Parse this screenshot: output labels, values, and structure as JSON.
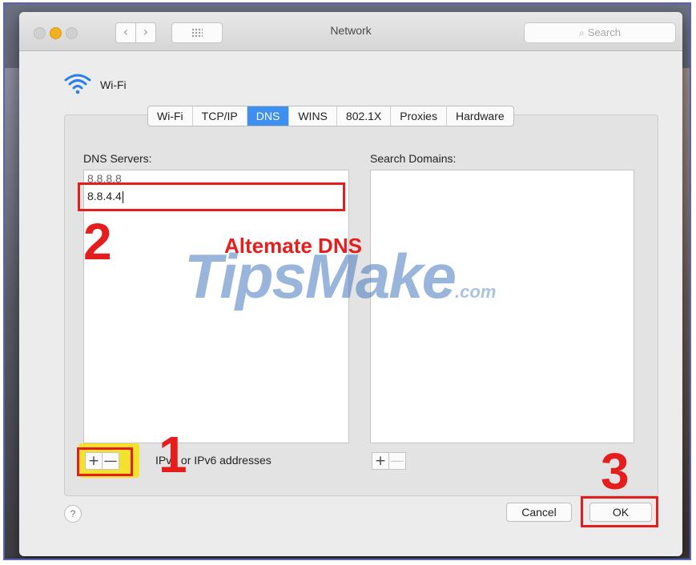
{
  "window": {
    "title": "Network"
  },
  "toolbar": {
    "back_glyph": "‹",
    "forward_glyph": "›",
    "search_placeholder": "Search",
    "icons": {
      "search": "search-icon",
      "grid": "show-all-grid-icon"
    }
  },
  "interface": {
    "name": "Wi-Fi",
    "icon": "wifi-icon"
  },
  "tabs": [
    {
      "label": "Wi-Fi",
      "active": false
    },
    {
      "label": "TCP/IP",
      "active": false
    },
    {
      "label": "DNS",
      "active": true
    },
    {
      "label": "WINS",
      "active": false
    },
    {
      "label": "802.1X",
      "active": false
    },
    {
      "label": "Proxies",
      "active": false
    },
    {
      "label": "Hardware",
      "active": false
    }
  ],
  "dns": {
    "servers_label": "DNS Servers:",
    "servers": [
      "8.8.8.8",
      "8.8.4.4"
    ],
    "hint": "IPv4 or IPv6 addresses",
    "add_glyph": "+",
    "remove_glyph": "—"
  },
  "search_domains": {
    "label": "Search Domains:",
    "add_glyph": "+",
    "remove_glyph": "—"
  },
  "footer": {
    "help_glyph": "?",
    "cancel_label": "Cancel",
    "ok_label": "OK"
  },
  "annotations": {
    "step1": "1",
    "step2": "2",
    "step3": "3",
    "alternate_label": "Altemate DNS",
    "color": "#e61d1d"
  },
  "watermark": {
    "text": "TipsMake",
    "suffix": ".com"
  },
  "colors": {
    "accent_tab": "#3d8ff0",
    "highlight_yellow": "#f4e12c",
    "frame_border": "#5a62b5"
  }
}
